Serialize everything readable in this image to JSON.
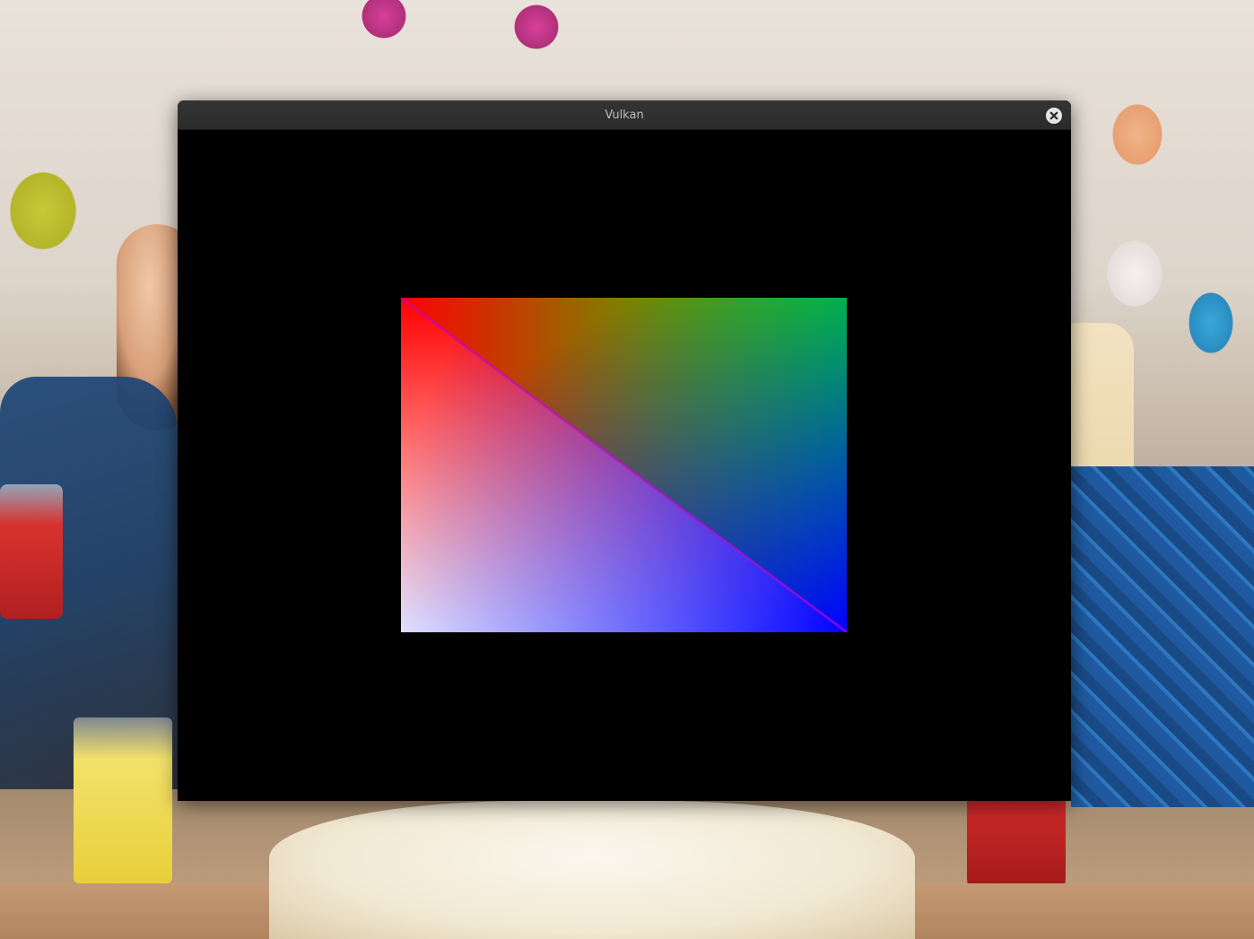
{
  "window": {
    "title": "Vulkan",
    "close_icon": "close-icon"
  },
  "render": {
    "background_color": "#000000",
    "quad_vertex_colors": {
      "top_left": "#ff0000",
      "top_right": "#00ff00",
      "bottom_right": "#0000ff",
      "bottom_left": "#ffffff"
    }
  }
}
